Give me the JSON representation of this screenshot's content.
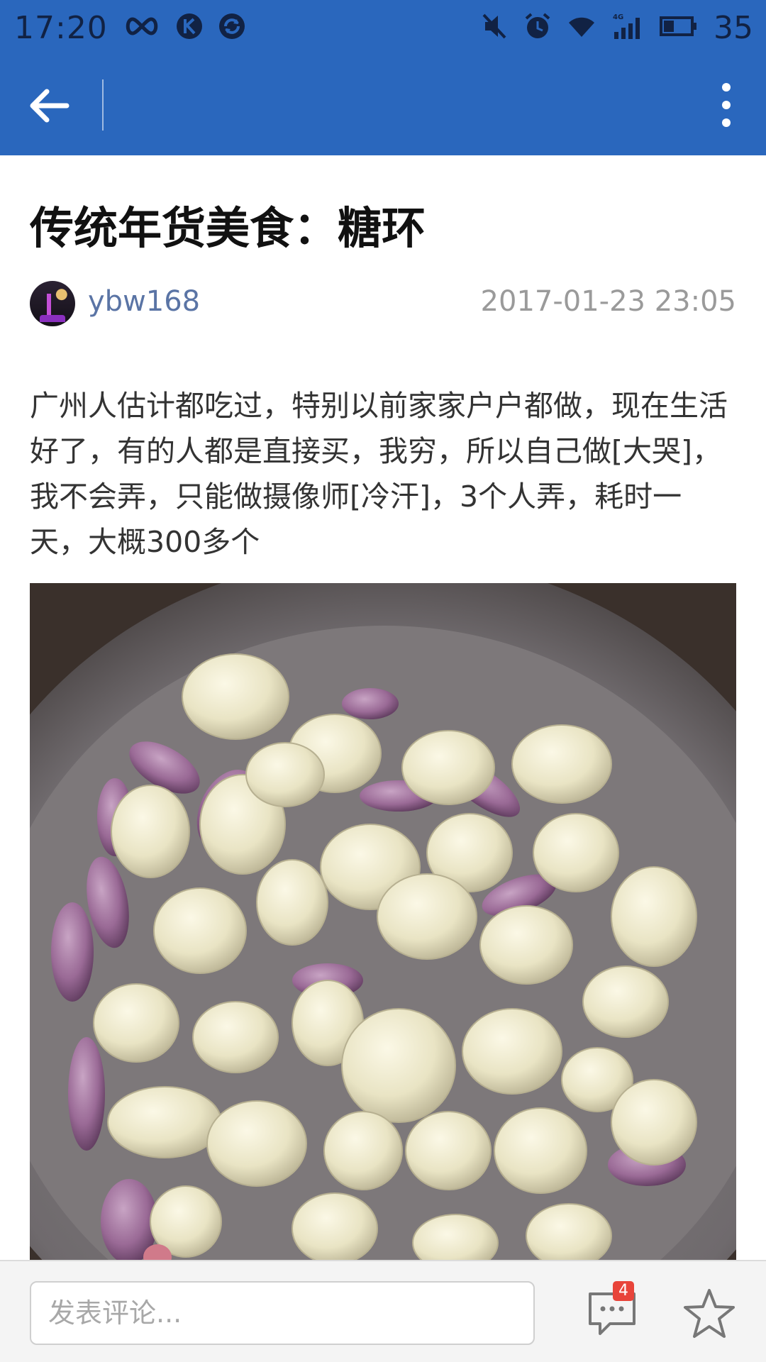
{
  "status_bar": {
    "time": "17:20",
    "battery_level": "35",
    "left_icons": [
      "infinity-icon",
      "k-app-icon",
      "refresh-app-icon"
    ],
    "right_icons": [
      "mute-icon",
      "alarm-icon",
      "wifi-icon",
      "signal-4g-icon",
      "battery-icon"
    ]
  },
  "app_bar": {
    "back_icon": "arrow-left-icon",
    "menu_icon": "more-vertical-icon"
  },
  "article": {
    "title": "传统年货美食：糖环",
    "author": "ybw168",
    "date": "2017-01-23 23:05",
    "body": "广州人估计都吃过，特别以前家家户户都做，现在生活好了，有的人都是直接买，我穷，所以自己做[大哭]，我不会弄，只能做摄像师[冷汗]，3个人弄，耗时一天，大概300多个",
    "image_subject": "peeled garlic cloves and purple shallots in a steel bowl"
  },
  "bottom_bar": {
    "comment_placeholder": "发表评论...",
    "comment_count": "4",
    "comment_icon": "comment-bubble-icon",
    "favorite_icon": "star-outline-icon"
  },
  "colors": {
    "header_blue": "#2a67bd",
    "author_link": "#5a74a5",
    "badge_red": "#e8443a"
  }
}
